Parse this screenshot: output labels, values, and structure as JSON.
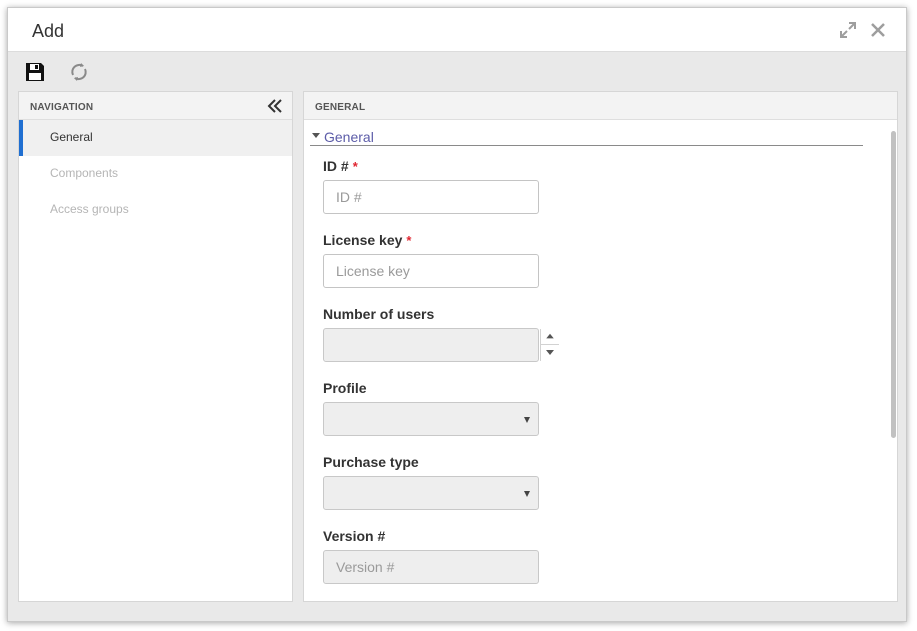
{
  "window": {
    "title": "Add"
  },
  "toolbar": {
    "save": "save-icon",
    "refresh": "refresh-icon"
  },
  "navigation": {
    "header": "NAVIGATION",
    "items": [
      {
        "label": "General",
        "active": true
      },
      {
        "label": "Components",
        "active": false
      },
      {
        "label": "Access groups",
        "active": false
      }
    ]
  },
  "content": {
    "header": "GENERAL",
    "section_title": "General",
    "fields": {
      "id": {
        "label": "ID #",
        "required": true,
        "placeholder": "ID #",
        "value": ""
      },
      "license_key": {
        "label": "License key",
        "required": true,
        "placeholder": "License key",
        "value": ""
      },
      "number_of_users": {
        "label": "Number of users",
        "value": ""
      },
      "profile": {
        "label": "Profile",
        "value": ""
      },
      "purchase_type": {
        "label": "Purchase type",
        "value": ""
      },
      "version": {
        "label": "Version #",
        "placeholder": "Version #",
        "value": ""
      }
    },
    "required_mark": "*"
  },
  "colors": {
    "accent": "#1f6fd1",
    "required": "#e0242f",
    "section_title": "#5c5ca8"
  }
}
